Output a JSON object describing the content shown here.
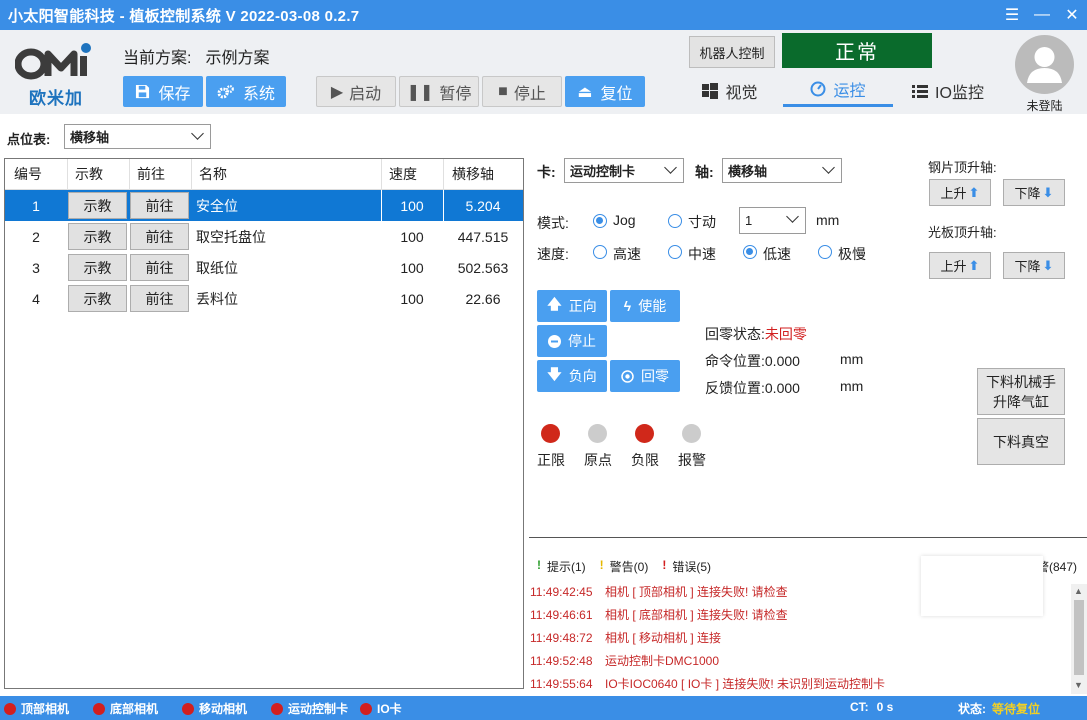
{
  "window": {
    "title": "小太阳智能科技 - 植板控制系统  V 2022-03-08 0.2.7"
  },
  "header": {
    "logo_text": "欧米加",
    "scheme_label": "当前方案:",
    "scheme_value": "示例方案",
    "buttons": {
      "save": "保存",
      "system": "系统",
      "start": "启动",
      "pause": "暂停",
      "stop": "停止",
      "reset": "复位"
    },
    "robot_control": "机器人控制",
    "status": "正常",
    "tabs": {
      "vision": "视觉",
      "motion": "运控",
      "io": "IO监控"
    },
    "user": "未登陆"
  },
  "point_table": {
    "label": "点位表:",
    "selected": "横移轴"
  },
  "table": {
    "columns": [
      "编号",
      "示教",
      "前往",
      "名称",
      "速度",
      "横移轴"
    ],
    "teach_label": "示教",
    "goto_label": "前往",
    "rows": [
      {
        "id": "1",
        "name": "安全位",
        "speed": "100",
        "axis": "5.204"
      },
      {
        "id": "2",
        "name": "取空托盘位",
        "speed": "100",
        "axis": "447.515"
      },
      {
        "id": "3",
        "name": "取纸位",
        "speed": "100",
        "axis": "502.563"
      },
      {
        "id": "4",
        "name": "丢料位",
        "speed": "100",
        "axis": "22.66"
      }
    ]
  },
  "motion": {
    "card_label": "卡:",
    "card_value": "运动控制卡",
    "axis_label": "轴:",
    "axis_value": "横移轴",
    "mode_label": "模式:",
    "mode_jog": "Jog",
    "mode_inch": "寸动",
    "inch_value": "1",
    "unit": "mm",
    "speed_label": "速度:",
    "speed_high": "高速",
    "speed_mid": "中速",
    "speed_low": "低速",
    "speed_slow": "极慢",
    "btn_forward": "正向",
    "btn_enable": "使能",
    "btn_stop": "停止",
    "btn_reverse": "负向",
    "btn_home": "回零",
    "home_state_label": "回零状态:",
    "home_state_value": "未回零",
    "cmd_pos_label": "命令位置:",
    "cmd_pos_value": "0.000",
    "fb_pos_label": "反馈位置:",
    "fb_pos_value": "0.000",
    "indicators": [
      {
        "label": "正限",
        "color": "#d0281a"
      },
      {
        "label": "原点",
        "color": "#cccccc"
      },
      {
        "label": "负限",
        "color": "#d0281a"
      },
      {
        "label": "报警",
        "color": "#cccccc"
      }
    ]
  },
  "side": {
    "steel_axis": "钢片顶升轴:",
    "light_axis": "光板顶升轴:",
    "up": "上升",
    "down": "下降",
    "unload_cyl": [
      "下料机械手",
      "升降气缸"
    ],
    "unload_vac": "下料真空"
  },
  "log": {
    "tab_tip": "提示(1)",
    "tab_warn": "警告(0)",
    "tab_err": "错误(5)",
    "tab_all": "警(847)",
    "lines": [
      {
        "time": "11:49:42:45",
        "msg": "相机 [ 顶部相机 ] 连接失败! 请检查"
      },
      {
        "time": "11:49:46:61",
        "msg": "相机 [ 底部相机 ] 连接失败! 请检查"
      },
      {
        "time": "11:49:48:72",
        "msg": "相机 [ 移动相机 ] 连接"
      },
      {
        "time": "11:49:52:48",
        "msg": "运动控制卡DMC1000"
      },
      {
        "time": "11:49:55:64",
        "msg": "IO卡IOC0640 [ IO卡 ] 连接失败! 未识别到运动控制卡"
      }
    ]
  },
  "statusbar": {
    "items": [
      "顶部相机",
      "底部相机",
      "移动相机",
      "运动控制卡",
      "IO卡"
    ],
    "ct_label": "CT:",
    "ct_value": "0 s",
    "state_label": "状态:",
    "state_value": "等待复位"
  }
}
